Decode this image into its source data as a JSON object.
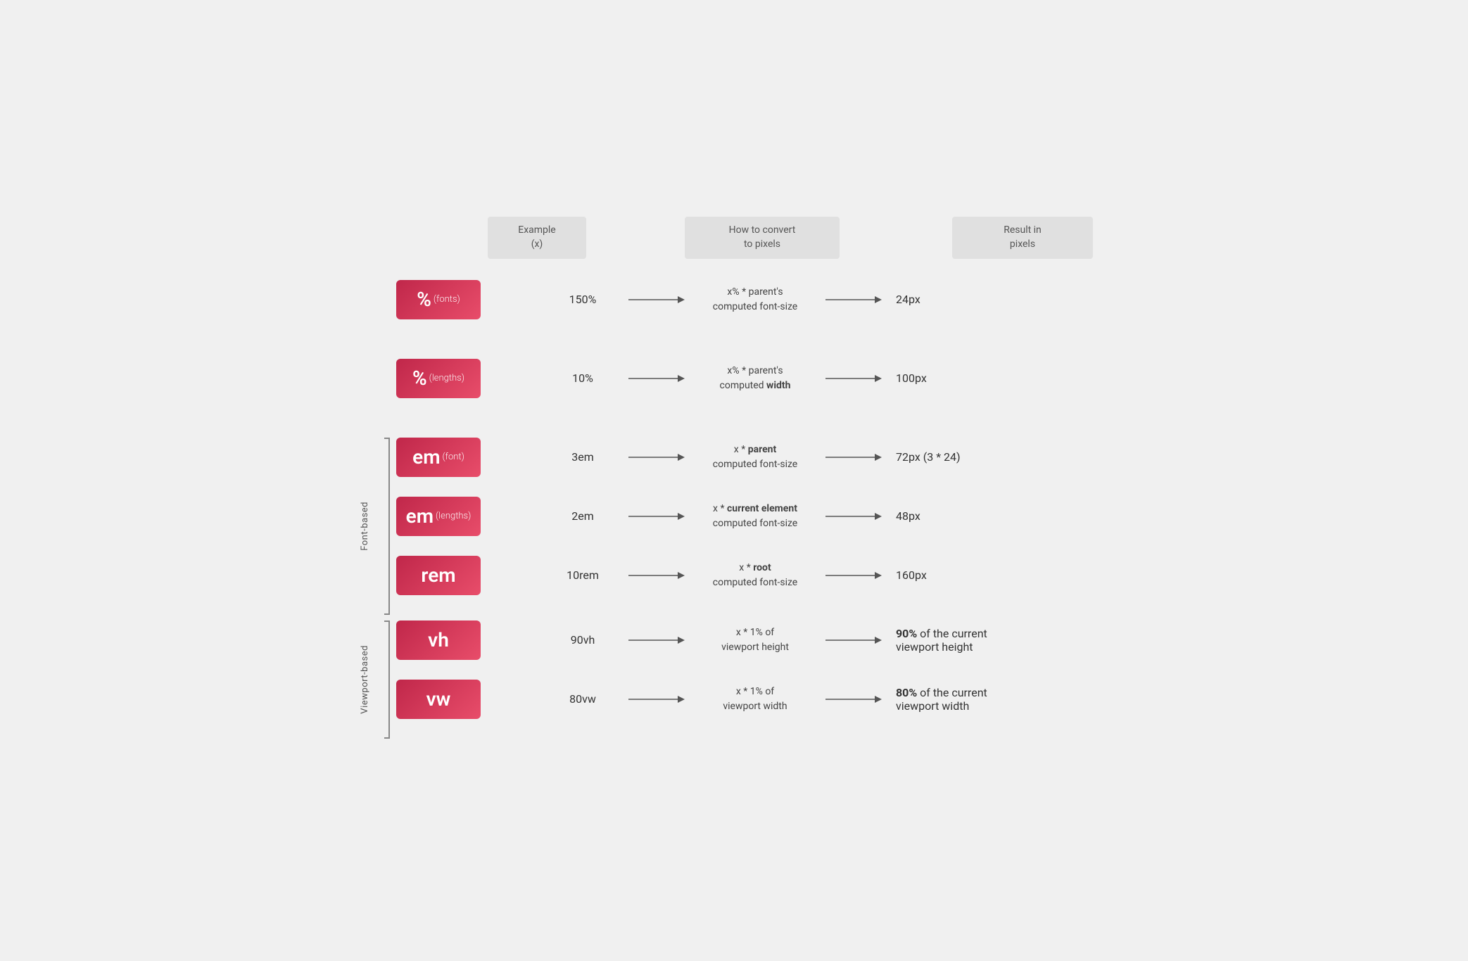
{
  "headers": {
    "example": "Example\n(x)",
    "convert": "How to convert\nto pixels",
    "result": "Result in\npixels"
  },
  "groups": [
    {
      "label": null,
      "rows": [
        {
          "unit_main": "%",
          "unit_sub": "(fonts)",
          "example": "150%",
          "convert_html": "x% * parent's\ncomputed font-size",
          "result_html": "24px"
        },
        {
          "unit_main": "%",
          "unit_sub": "(lengths)",
          "example": "10%",
          "convert_html": "x% * parent's\ncomputed <b>width</b>",
          "result_html": "100px"
        }
      ]
    },
    {
      "label": "Font-based",
      "rows": [
        {
          "unit_main": "em",
          "unit_sub": "(font)",
          "example": "3em",
          "convert_html": "x * <b>parent</b>\ncomputed font-size",
          "result_html": "72px (3 * 24)"
        },
        {
          "unit_main": "em",
          "unit_sub": "(lengths)",
          "example": "2em",
          "convert_html": "x * <b>current element</b>\ncomputed font-size",
          "result_html": "48px"
        },
        {
          "unit_main": "rem",
          "unit_sub": "",
          "example": "10rem",
          "convert_html": "x * <b>root</b>\ncomputed font-size",
          "result_html": "160px"
        }
      ]
    },
    {
      "label": "Viewport-based",
      "rows": [
        {
          "unit_main": "vh",
          "unit_sub": "",
          "example": "90vh",
          "convert_html": "x * 1% of\nviewport height",
          "result_html": "<b>90%</b> of the current\nviewport height"
        },
        {
          "unit_main": "vw",
          "unit_sub": "",
          "example": "80vw",
          "convert_html": "x * 1% of\nviewport width",
          "result_html": "<b>80%</b> of the current\nviewport width"
        }
      ]
    }
  ],
  "colors": {
    "badge_gradient_start": "#c0274a",
    "badge_gradient_end": "#e84d6a",
    "arrow_color": "#333",
    "header_bg": "#e0e0e0"
  }
}
